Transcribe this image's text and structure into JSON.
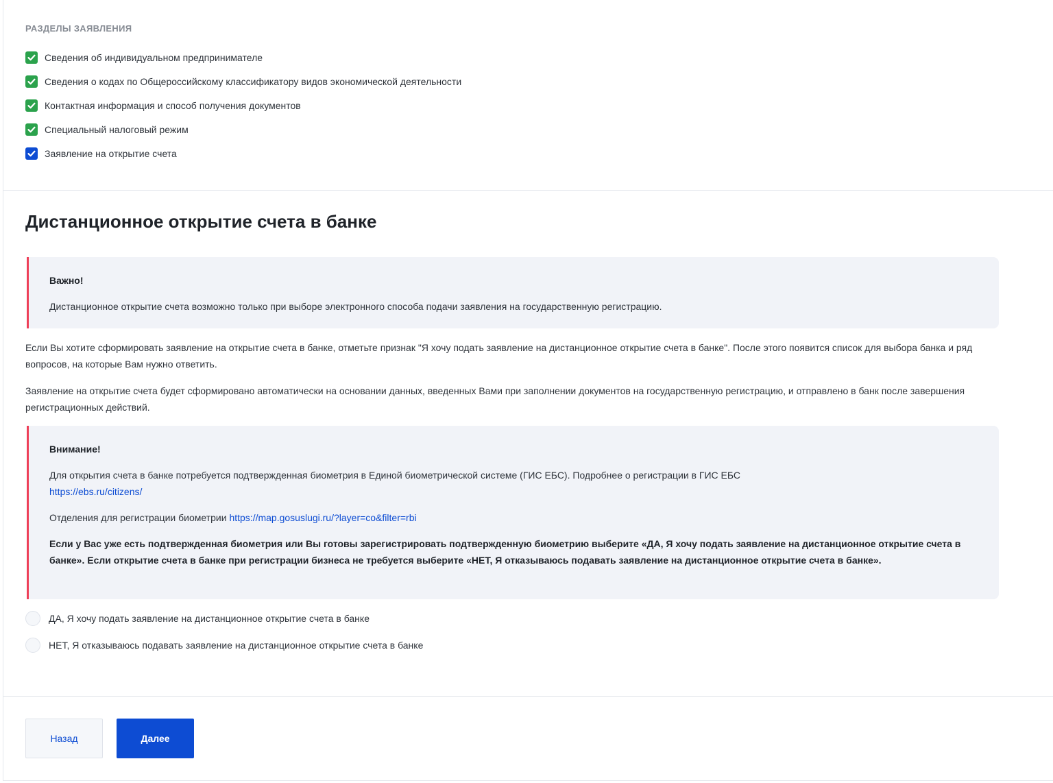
{
  "sections": {
    "title": "РАЗДЕЛЫ ЗАЯВЛЕНИЯ",
    "items": [
      {
        "label": "Сведения об индивидуальном предпринимателе",
        "checked": true,
        "color": "#2ba24c"
      },
      {
        "label": "Сведения о кодах по Общероссийскому классификатору видов экономической деятельности",
        "checked": true,
        "color": "#2ba24c"
      },
      {
        "label": "Контактная информация и способ получения документов",
        "checked": true,
        "color": "#2ba24c"
      },
      {
        "label": "Специальный налоговый режим",
        "checked": true,
        "color": "#2ba24c"
      },
      {
        "label": "Заявление на открытие счета",
        "checked": true,
        "color": "#0d4cd3"
      }
    ]
  },
  "main": {
    "heading": "Дистанционное открытие счета в банке",
    "important": {
      "title": "Важно!",
      "text": "Дистанционное открытие счета возможно только при выборе электронного способа подачи заявления на государственную регистрацию."
    },
    "paragraph1": "Если Вы хотите сформировать заявление на открытие счета в банке, отметьте признак \"Я хочу подать заявление на дистанционное открытие счета в банке\". После этого появится список для выбора банка и ряд вопросов, на которые Вам нужно ответить.",
    "paragraph2": "Заявление на открытие счета будет сформировано автоматически на основании данных, введенных Вами при заполнении документов на государственную регистрацию, и отправлено в банк после завершения регистрационных действий.",
    "attention": {
      "title": "Внимание!",
      "text1": "Для открытия счета в банке потребуется подтвержденная биометрия в Единой биометрической системе (ГИС ЕБС). Подробнее о регистрации в ГИС ЕБС",
      "link1": "https://ebs.ru/citizens/",
      "text2": "Отделения для регистрации биометрии",
      "link2": "https://map.gosuslugi.ru/?layer=co&filter=rbi",
      "bold_text": "Если у Вас уже есть подтвержденная биометрия или Вы готовы зарегистрировать подтвержденную биометрию выберите «ДА, Я хочу подать заявление на дистанционное открытие счета в банке». Если открытие счета в банке при регистрации бизнеса не требуется выберите «НЕТ, Я отказываюсь подавать заявление на дистанционное открытие счета в банке»."
    },
    "options": [
      {
        "label": "ДА, Я хочу подать заявление на дистанционное открытие счета в банке",
        "selected": false
      },
      {
        "label": "НЕТ, Я отказываюсь подавать заявление на дистанционное открытие счета в банке",
        "selected": false
      }
    ]
  },
  "footer": {
    "back_label": "Назад",
    "next_label": "Далее"
  },
  "colors": {
    "accent": "#0d4cd3",
    "success": "#2ba24c",
    "alert_border": "#ee3f58",
    "alert_bg": "#f1f3f8"
  }
}
